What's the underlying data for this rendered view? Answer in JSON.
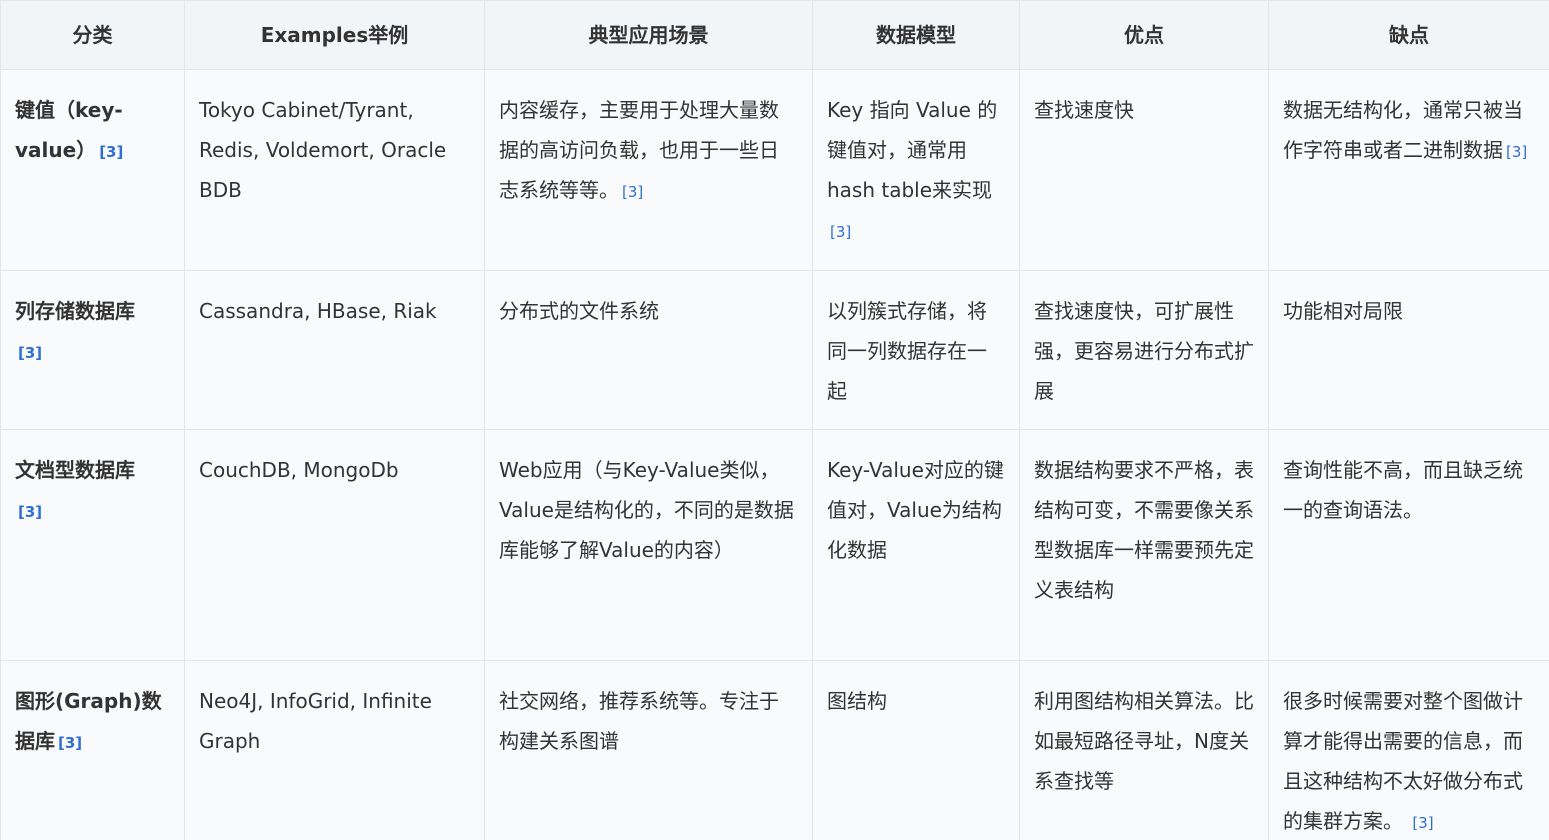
{
  "headers": [
    "分类",
    "Examples举例",
    "典型应用场景",
    "数据模型",
    "优点",
    "缺点"
  ],
  "rows": [
    {
      "category": "键值（key-value）",
      "category_ref": "[3]",
      "examples": "Tokyo Cabinet/Tyrant, Redis, Voldemort, Oracle BDB",
      "scenario": "内容缓存，主要用于处理大量数据的高访问负载，也用于一些日志系统等等。",
      "scenario_ref": "[3]",
      "model": "Key 指向 Value 的键值对，通常用hash table来实现",
      "model_ref": "[3]",
      "pros": "查找速度快",
      "cons": "数据无结构化，通常只被当作字符串或者二进制数据",
      "cons_ref": "[3]"
    },
    {
      "category": "列存储数据库",
      "category_ref": "[3]",
      "examples": "Cassandra, HBase, Riak",
      "scenario": "分布式的文件系统",
      "model": "以列簇式存储，将同一列数据存在一起",
      "pros": "查找速度快，可扩展性强，更容易进行分布式扩展",
      "cons": "功能相对局限"
    },
    {
      "category": "文档型数据库",
      "category_ref": "[3]",
      "examples": "CouchDB, MongoDb",
      "scenario": "Web应用（与Key-Value类似，Value是结构化的，不同的是数据库能够了解Value的内容）",
      "model": "Key-Value对应的键值对，Value为结构化数据",
      "pros": "数据结构要求不严格，表结构可变，不需要像关系型数据库一样需要预先定义表结构",
      "cons": "查询性能不高，而且缺乏统一的查询语法。"
    },
    {
      "category": "图形(Graph)数据库",
      "category_ref": "[3]",
      "examples": "Neo4J, InfoGrid, Infinite Graph",
      "scenario": "社交网络，推荐系统等。专注于构建关系图谱",
      "model": "图结构",
      "pros": "利用图结构相关算法。比如最短路径寻址，N度关系查找等",
      "cons": "很多时候需要对整个图做计算才能得出需要的信息，而且这种结构不太好做分布式的集群方案。",
      "cons_ref": "[3]"
    }
  ],
  "colors": {
    "header_bg": "#f2f5f8",
    "cell_bg": "#f9fafb",
    "border": "#e6e6e6",
    "text": "#333333",
    "ref_link": "#2f6fd1"
  }
}
